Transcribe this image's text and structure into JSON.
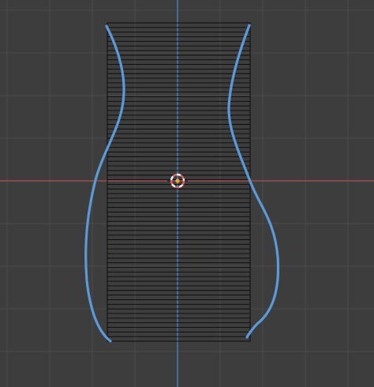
{
  "viewport": {
    "view": "front-orthographic",
    "background_color": "#3d3d3d",
    "grid_color": "#4a4a4a",
    "x_axis_color": "#b14d55",
    "z_axis_color": "#4a86c6"
  },
  "mesh": {
    "type": "cylinder-wireframe",
    "edge_color": "#0b0b0b",
    "horizontal_loops": 69
  },
  "profile_curve": {
    "color": "#5b9ad8",
    "selected": true
  },
  "cursor_3d": {
    "ring_colors": [
      "#e06060",
      "#f0f0f0"
    ],
    "origin_color": "#f5a623"
  }
}
